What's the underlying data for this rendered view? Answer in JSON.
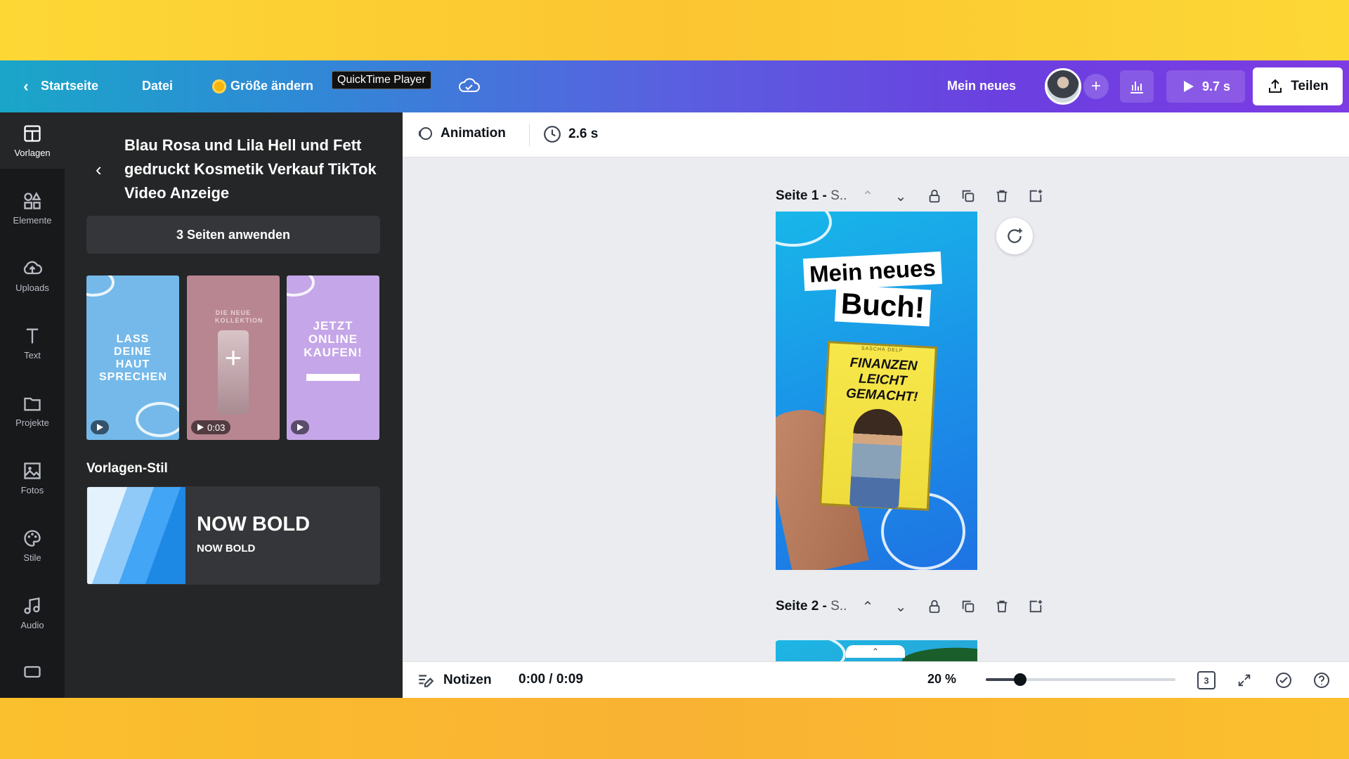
{
  "topbar": {
    "home_label": "Startseite",
    "file_label": "Datei",
    "resize_label": "Größe ändern",
    "tooltip": "QuickTime Player",
    "design_title": "Mein neues",
    "duration": "9.7 s",
    "share_label": "Teilen"
  },
  "rail": {
    "items": [
      {
        "label": "Vorlagen",
        "icon": "templates-icon"
      },
      {
        "label": "Elemente",
        "icon": "elements-icon"
      },
      {
        "label": "Uploads",
        "icon": "upload-cloud-icon"
      },
      {
        "label": "Text",
        "icon": "text-icon"
      },
      {
        "label": "Projekte",
        "icon": "folder-icon"
      },
      {
        "label": "Fotos",
        "icon": "image-icon"
      },
      {
        "label": "Stile",
        "icon": "palette-icon"
      },
      {
        "label": "Audio",
        "icon": "music-icon"
      }
    ]
  },
  "panel": {
    "title": "Blau Rosa und Lila Hell und Fett gedruckt Kosmetik Verkauf TikTok Video Anzeige",
    "apply_label": "3 Seiten anwenden",
    "thumbnails": [
      {
        "text": "LASS DEINE HAUT SPRECHEN",
        "duration": "",
        "color": "#74b9ea"
      },
      {
        "text": "DIE NEUE KOLLEKTION",
        "duration": "0:03",
        "color": "#b88691"
      },
      {
        "text": "JETZT ONLINE KAUFEN!",
        "duration": "",
        "color": "#c5a6e8"
      }
    ],
    "style_section_label": "Vorlagen-Stil",
    "style_font_primary": "NOW BOLD",
    "style_font_secondary": "NOW BOLD"
  },
  "subbar": {
    "animation_label": "Animation",
    "page_duration": "2.6 s"
  },
  "canvas": {
    "page1_label": "Seite 1 - ",
    "page1_suffix": "S..",
    "page2_label": "Seite 2 - ",
    "page2_suffix": "S..",
    "page1_headline_1": "Mein neues",
    "page1_headline_2": "Buch!",
    "book_author": "SASCHA DELP",
    "book_title": "FINANZEN LEICHT GEMACHT!"
  },
  "bottombar": {
    "notes_label": "Notizen",
    "timecode": "0:00 / 0:09",
    "zoom_label": "20 %",
    "zoom_fraction": 0.18,
    "page_count": "3"
  }
}
